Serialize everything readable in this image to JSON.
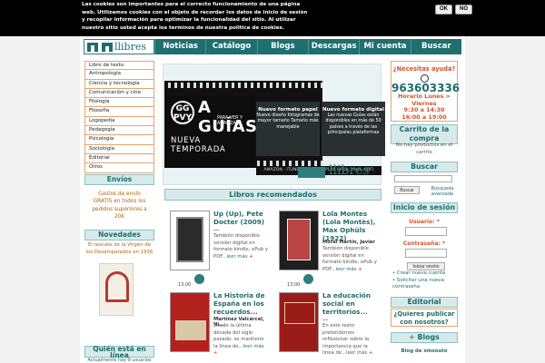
{
  "cookie": {
    "text": "Las cookies son importantes para el correcto funcionamiento de una página web. Utilizamos cookies con el objeto de recordar los datos de inicio de sesión y recopilar información para optimizar la funcionalidad del sitio. Al utilizar nuestro sitio usted acepta los terminos de nuestra politica de cookies.",
    "ok": "OK",
    "no": "NO"
  },
  "header": {
    "logo_text": "llibres",
    "nav": [
      "Noticias",
      "Catálogo",
      "Blogs",
      "Descargas",
      "Mi cuenta",
      "Buscar"
    ]
  },
  "categories": [
    "Libro de texto",
    "Antropología",
    "Ciencia y tecnología",
    "Comunicación y cine",
    "Filología",
    "Filosofía",
    "Logopedia",
    "Pedagogía",
    "Psicología",
    "Sociología",
    "Editorial",
    "Otros"
  ],
  "envios": {
    "title": "Envíos",
    "line1": "Gastos de envío",
    "line2": "GRATIS en todos los",
    "line3": "pedidos superiores a",
    "line4": "20€"
  },
  "novedades": {
    "title": "Novedades",
    "text": "El rescate de la Virgen de los Desamparados en 1936"
  },
  "online": {
    "title": "Quién está en línea",
    "text": "Actualmente hay 9 usuarios"
  },
  "banner": {
    "gg": "GG",
    "pvy": "PVY",
    "a": "A",
    "guias": "GUÍAS",
    "sub1": "PARA VER Y",
    "sub2": "ANALIZAR",
    "nueva": "NUEVA TEMPORADA",
    "cell1_title": "Nuevo formato papel",
    "cell1_text": "Nuevo diseño fotogramas de mayor tamaño Tamaño más manejable",
    "cell2_title": "Nuevo formato digital",
    "cell2_text": "Las nuevas Guías están disponibles en más de 50 países a través de las principales plataformas",
    "strip": "AMAZON - ITUNES - GOOGLE PLAY (ePub, mobi, PDF)",
    "logo_text": "llibres"
  },
  "recommended": {
    "title": "Libros recomendados",
    "books": [
      {
        "title": "Up (Up), Pete Docter (2009)",
        "author": "...",
        "desc": "También disponible versión digital en formato kindle, ePub y PDF...",
        "more": "leer más",
        "price": "13,00"
      },
      {
        "title": "Lola Montes (Lola Montès), Max Ophüls (1922)",
        "author": "Moral Martín, Javier",
        "desc": "También disponible versión digital en formato kindle, ePub y PDF...",
        "more": "leer más",
        "price": "13,00"
      },
      {
        "title": "La Historia de España en los recuerdos...",
        "author": "Martínez Valcárcel, Ni...",
        "desc": "Desde la última década del siglo pasado, se mantiene la línea de...",
        "more": "leer más",
        "price": ""
      },
      {
        "title": "La educación social en territorios...",
        "author": "...",
        "desc": "En este texto pretendemos reflexionar sobre la importancia que la línea de...",
        "more": "leer más",
        "price": ""
      }
    ]
  },
  "help": {
    "title": "¿Necesitas ayuda?",
    "phone": "963603336",
    "hours_label": "Horario Lunes > Viernes",
    "hours1": "9:30 a 14:30",
    "hours2": "16:00 a 19:00"
  },
  "cart": {
    "title": "Carrito de la compra",
    "empty": "No hay productos en el carrito"
  },
  "search": {
    "title": "Buscar",
    "button": "Buscar",
    "advanced": "Búsqueda avanzada"
  },
  "login": {
    "title": "Inicio de sesión",
    "user_label": "Usuario:",
    "pass_label": "Contraseña:",
    "button": "Iniciar sesión",
    "create": "Crear nueva cuenta",
    "request": "Solicitar una nueva contraseña"
  },
  "editorial": {
    "title": "Editorial",
    "question": "¿Quieres publicar con nosotros?"
  },
  "blogs": {
    "title": "Blogs",
    "item": "Blog de xmsouto"
  },
  "colors": {
    "teal": "#1e6f6f",
    "orange": "#d0542a",
    "border_orange": "#e3a66b"
  }
}
